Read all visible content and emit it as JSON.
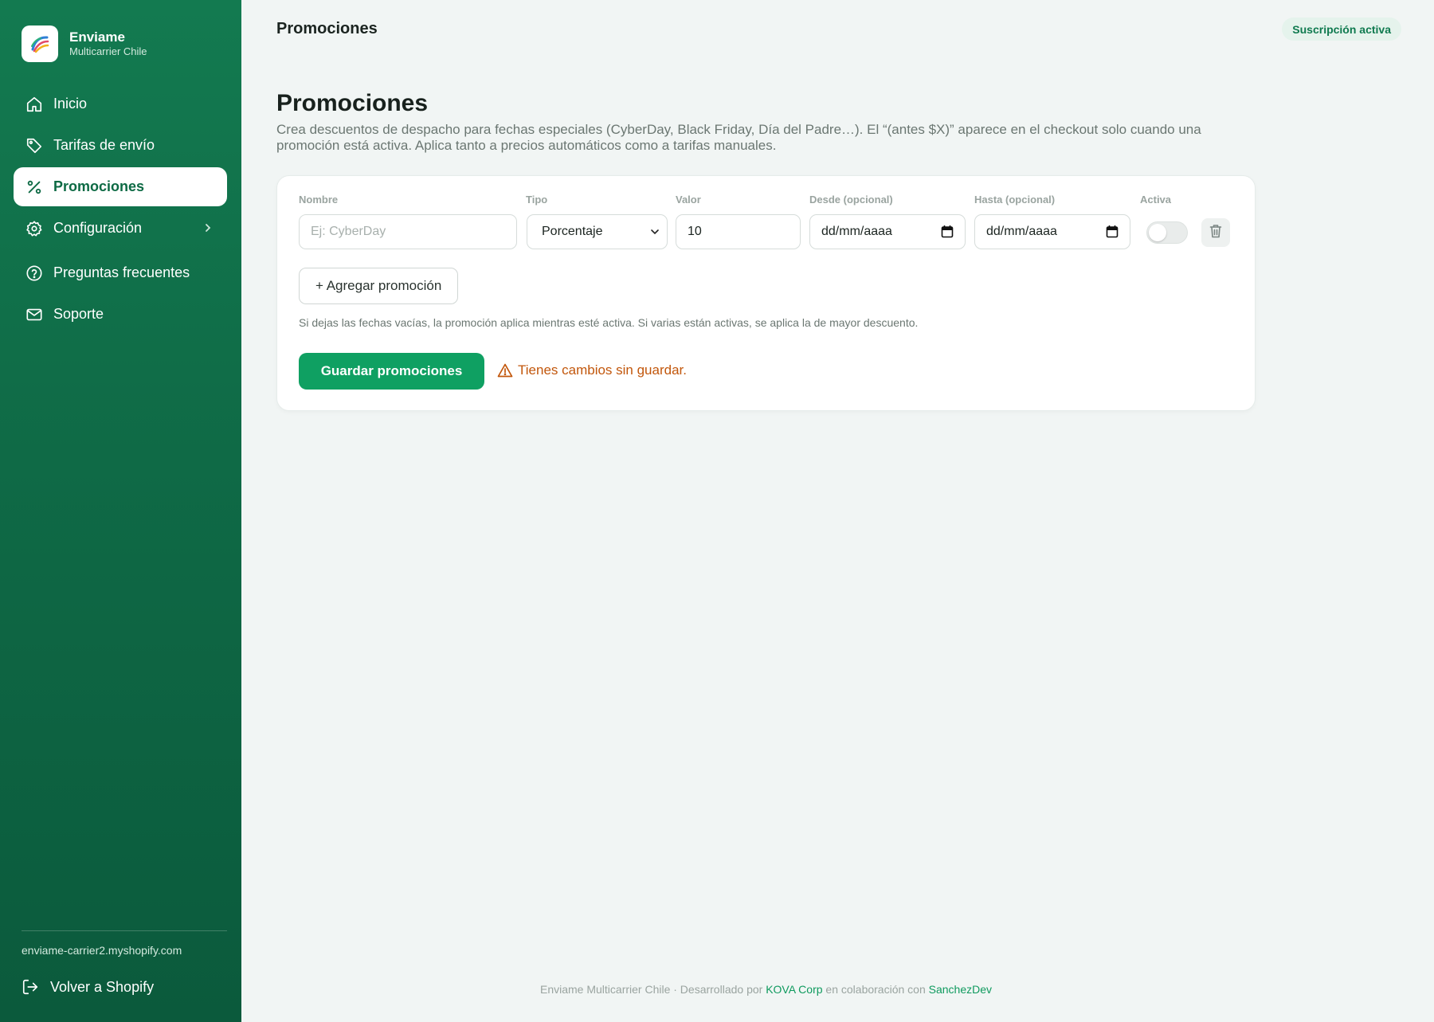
{
  "brand": {
    "name": "Enviame",
    "subtitle": "Multicarrier Chile"
  },
  "sidebar": {
    "items": [
      {
        "label": "Inicio",
        "icon": "home-icon"
      },
      {
        "label": "Tarifas de envío",
        "icon": "tag-icon"
      },
      {
        "label": "Promociones",
        "icon": "percent-icon",
        "active": true
      },
      {
        "label": "Configuración",
        "icon": "gear-icon",
        "has_submenu": true
      },
      {
        "label": "Preguntas frecuentes",
        "icon": "help-circle-icon"
      },
      {
        "label": "Soporte",
        "icon": "mail-icon"
      }
    ],
    "shop_domain": "enviame-carrier2.myshopify.com",
    "back_label": "Volver a Shopify"
  },
  "header": {
    "title": "Promociones",
    "subscription_badge": "Suscripción activa"
  },
  "main": {
    "title": "Promociones",
    "description": "Crea descuentos de despacho para fechas especiales (CyberDay, Black Friday, Día del Padre…). El “(antes $X)” aparece en el checkout solo cuando una promoción está activa. Aplica tanto a precios automáticos como a tarifas manuales."
  },
  "form": {
    "labels": {
      "nombre": "Nombre",
      "tipo": "Tipo",
      "valor": "Valor",
      "desde": "Desde (opcional)",
      "hasta": "Hasta (opcional)",
      "activa": "Activa"
    },
    "row": {
      "nombre_value": "",
      "nombre_placeholder": "Ej: CyberDay",
      "tipo_selected": "Porcentaje",
      "valor_value": "10",
      "desde_value": "dd/mm/aaaa",
      "hasta_value": "dd/mm/aaaa",
      "activa": false
    },
    "add_label": "+ Agregar promoción",
    "hint": "Si dejas las fechas vacías, la promoción aplica mientras esté activa. Si varias están activas, se aplica la de mayor descuento.",
    "save_label": "Guardar promociones",
    "unsaved_warning": "Tienes cambios sin guardar."
  },
  "footer": {
    "prefix": "Enviame Multicarrier Chile · Desarrollado por",
    "company": "KOVA Corp",
    "middle": "en colaboración con",
    "partner": "SanchezDev"
  },
  "colors": {
    "sidebar_green": "#137a50",
    "accent_green": "#0fa062",
    "warning_orange": "#c2570c",
    "background": "#f1f5f4"
  }
}
